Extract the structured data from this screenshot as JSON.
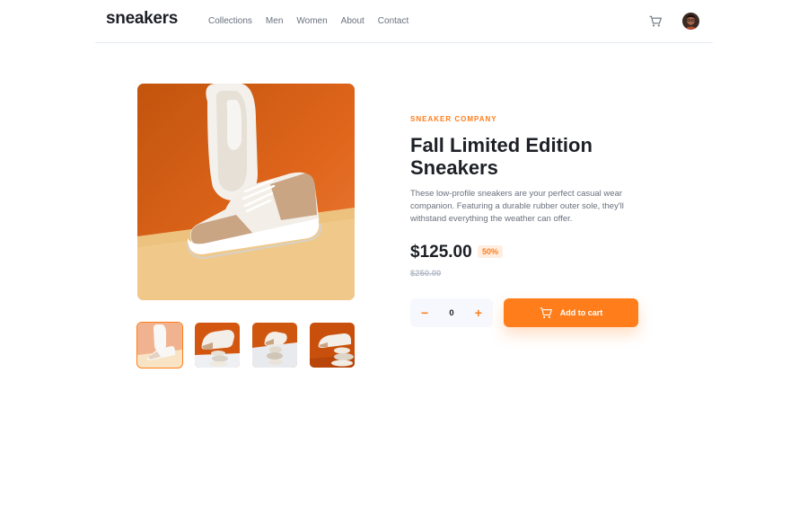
{
  "header": {
    "logo": "sneakers",
    "nav": [
      "Collections",
      "Men",
      "Women",
      "About",
      "Contact"
    ],
    "cart_icon": "cart-icon",
    "avatar_icon": "avatar"
  },
  "gallery": {
    "main_image": "sneaker-product-photo",
    "thumbnails": [
      "thumbnail-1",
      "thumbnail-2",
      "thumbnail-3",
      "thumbnail-4"
    ],
    "active_thumbnail": 0
  },
  "product": {
    "company": "SNEAKER COMPANY",
    "title": "Fall Limited Edition Sneakers",
    "description": "These low-profile sneakers are your perfect casual wear companion. Featuring a durable rubber outer sole, they'll withstand everything the weather can offer.",
    "price": "$125.00",
    "discount": "50%",
    "old_price": "$250.00"
  },
  "cart_controls": {
    "minus": "−",
    "quantity": "0",
    "plus": "+",
    "add_to_cart_label": "Add to cart"
  },
  "colors": {
    "accent": "#ff7e1b",
    "accent_pale": "#ffede0",
    "text_dark": "#1d2026",
    "text_muted": "#69707d",
    "text_light": "#b6bcc8"
  }
}
